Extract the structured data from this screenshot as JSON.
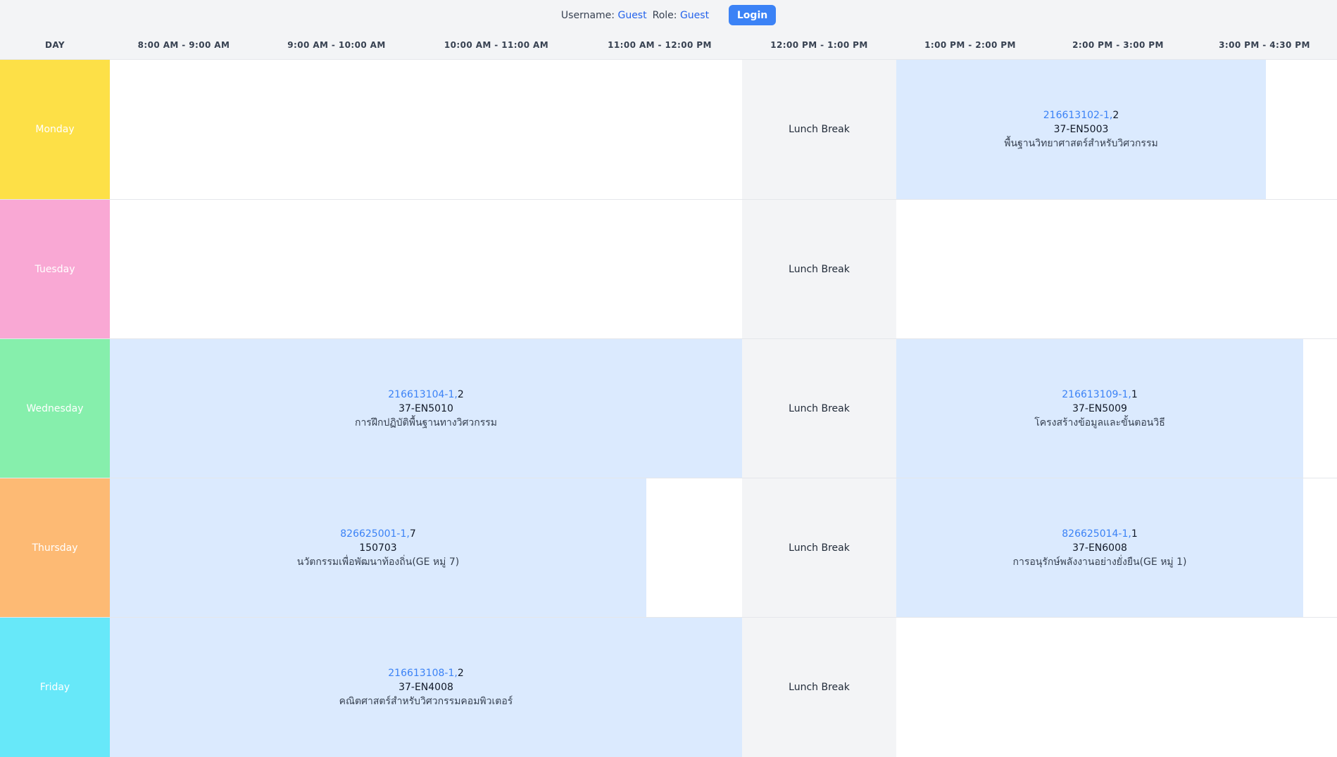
{
  "user_bar": {
    "username_label": "Username:",
    "username_value": "Guest",
    "role_label": "Role:",
    "role_value": "Guest",
    "login_label": "Login"
  },
  "header": {
    "day_label": "DAY",
    "slots": [
      "8:00 AM - 9:00 AM",
      "9:00 AM - 10:00 AM",
      "10:00 AM - 11:00 AM",
      "11:00 AM - 12:00 PM",
      "12:00 PM - 1:00 PM",
      "1:00 PM - 2:00 PM",
      "2:00 PM - 3:00 PM",
      "3:00 PM - 4:30 PM"
    ]
  },
  "lunch_label": "Lunch Break",
  "colors": {
    "monday": "#fde047",
    "tuesday": "#f9a8d4",
    "wednesday": "#86efac",
    "thursday": "#fdba74",
    "friday": "#67e8f9",
    "course_bg": "#dbeafe",
    "lunch_bg": "#f3f4f6",
    "accent": "#3b82f6"
  },
  "days": [
    {
      "name": "Monday",
      "courses": [
        {
          "code": "216613102-1,",
          "section": "2",
          "room": "37-EN5003",
          "title": "พื้นฐานวิทยาศาสตร์สำหรับวิศวกรรม"
        }
      ]
    },
    {
      "name": "Tuesday",
      "courses": []
    },
    {
      "name": "Wednesday",
      "courses": [
        {
          "code": "216613104-1,",
          "section": "2",
          "room": "37-EN5010",
          "title": "การฝึกปฏิบัติพื้นฐานทางวิศวกรรม"
        },
        {
          "code": "216613109-1,",
          "section": "1",
          "room": "37-EN5009",
          "title": "โครงสร้างข้อมูลและขั้นตอนวิธี"
        }
      ]
    },
    {
      "name": "Thursday",
      "courses": [
        {
          "code": "826625001-1,",
          "section": "7",
          "room": "150703",
          "title": "นวัตกรรมเพื่อพัฒนาท้องถิ่น(GE หมู่ 7)"
        },
        {
          "code": "826625014-1,",
          "section": "1",
          "room": "37-EN6008",
          "title": "การอนุรักษ์พลังงานอย่างยั่งยืน(GE หมู่ 1)"
        }
      ]
    },
    {
      "name": "Friday",
      "courses": [
        {
          "code": "216613108-1,",
          "section": "2",
          "room": "37-EN4008",
          "title": "คณิตศาสตร์สำหรับวิศวกรรมคอมพิวเตอร์"
        }
      ]
    }
  ]
}
